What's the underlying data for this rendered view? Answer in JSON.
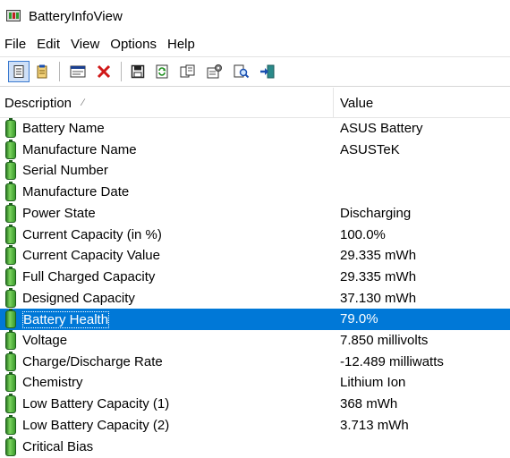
{
  "window": {
    "title": "BatteryInfoView"
  },
  "menu": [
    "File",
    "Edit",
    "View",
    "Options",
    "Help"
  ],
  "toolbar": {
    "buttons": [
      {
        "icon": "view-mode-icon",
        "pressed": true
      },
      {
        "icon": "notes-icon",
        "pressed": false
      },
      {
        "icon": "window-icon",
        "pressed": false
      },
      {
        "icon": "delete-icon",
        "pressed": false
      },
      {
        "icon": "save-icon",
        "pressed": false
      },
      {
        "icon": "refresh-icon",
        "pressed": false
      },
      {
        "icon": "copy-icon",
        "pressed": false
      },
      {
        "icon": "properties-icon",
        "pressed": false
      },
      {
        "icon": "find-icon",
        "pressed": false
      },
      {
        "icon": "exit-icon",
        "pressed": false
      }
    ]
  },
  "columns": {
    "description": "Description",
    "value": "Value"
  },
  "rows": [
    {
      "description": "Battery Name",
      "value": "ASUS Battery"
    },
    {
      "description": "Manufacture Name",
      "value": "ASUSTeK"
    },
    {
      "description": "Serial Number",
      "value": ""
    },
    {
      "description": "Manufacture Date",
      "value": ""
    },
    {
      "description": "Power State",
      "value": "Discharging"
    },
    {
      "description": "Current Capacity (in %)",
      "value": "100.0%"
    },
    {
      "description": "Current Capacity Value",
      "value": "29.335 mWh"
    },
    {
      "description": "Full Charged Capacity",
      "value": "29.335 mWh"
    },
    {
      "description": "Designed Capacity",
      "value": "37.130 mWh"
    },
    {
      "description": "Battery Health",
      "value": "79.0%",
      "selected": true
    },
    {
      "description": "Voltage",
      "value": "7.850 millivolts"
    },
    {
      "description": "Charge/Discharge Rate",
      "value": "-12.489 milliwatts"
    },
    {
      "description": "Chemistry",
      "value": "Lithium Ion"
    },
    {
      "description": "Low Battery Capacity (1)",
      "value": "368 mWh"
    },
    {
      "description": "Low Battery Capacity (2)",
      "value": "3.713 mWh"
    },
    {
      "description": "Critical Bias",
      "value": ""
    }
  ],
  "colors": {
    "selection": "#0078d7",
    "battery_icon": "#3a9a2c"
  }
}
